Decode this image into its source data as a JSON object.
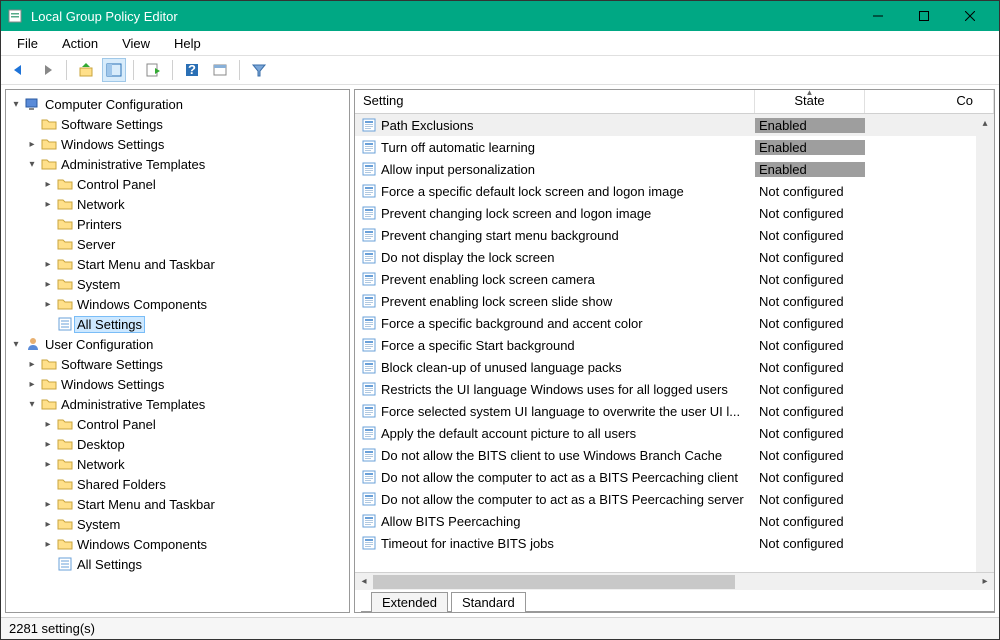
{
  "titlebar": {
    "title": "Local Group Policy Editor"
  },
  "menu": {
    "file": "File",
    "action": "Action",
    "view": "View",
    "help": "Help"
  },
  "tree": {
    "computer": "Computer Configuration",
    "user": "User Configuration",
    "software": "Software Settings",
    "windows": "Windows Settings",
    "admin": "Administrative Templates",
    "cp": "Control Panel",
    "network": "Network",
    "printers": "Printers",
    "server": "Server",
    "startmenu": "Start Menu and Taskbar",
    "system": "System",
    "wincomp": "Windows Components",
    "allsettings": "All Settings",
    "desktop": "Desktop",
    "shared": "Shared Folders"
  },
  "columns": {
    "setting": "Setting",
    "state": "State",
    "comment": "Co"
  },
  "rows": [
    {
      "name": "Path Exclusions",
      "state": "Enabled",
      "enabled": true,
      "sel": true
    },
    {
      "name": "Turn off automatic learning",
      "state": "Enabled",
      "enabled": true
    },
    {
      "name": "Allow input personalization",
      "state": "Enabled",
      "enabled": true
    },
    {
      "name": "Force a specific default lock screen and logon image",
      "state": "Not configured"
    },
    {
      "name": "Prevent changing lock screen and logon image",
      "state": "Not configured"
    },
    {
      "name": "Prevent changing start menu background",
      "state": "Not configured"
    },
    {
      "name": "Do not display the lock screen",
      "state": "Not configured"
    },
    {
      "name": "Prevent enabling lock screen camera",
      "state": "Not configured"
    },
    {
      "name": "Prevent enabling lock screen slide show",
      "state": "Not configured"
    },
    {
      "name": "Force a specific background and accent color",
      "state": "Not configured"
    },
    {
      "name": "Force a specific Start background",
      "state": "Not configured"
    },
    {
      "name": "Block clean-up of unused language packs",
      "state": "Not configured"
    },
    {
      "name": "Restricts the UI language Windows uses for all logged users",
      "state": "Not configured"
    },
    {
      "name": "Force selected system UI language to overwrite the user UI l...",
      "state": "Not configured"
    },
    {
      "name": "Apply the default account picture to all users",
      "state": "Not configured"
    },
    {
      "name": "Do not allow the BITS client to use Windows Branch Cache",
      "state": "Not configured"
    },
    {
      "name": "Do not allow the computer to act as a BITS Peercaching client",
      "state": "Not configured"
    },
    {
      "name": "Do not allow the computer to act as a BITS Peercaching server",
      "state": "Not configured"
    },
    {
      "name": "Allow BITS Peercaching",
      "state": "Not configured"
    },
    {
      "name": "Timeout for inactive BITS jobs",
      "state": "Not configured"
    }
  ],
  "tabs": {
    "extended": "Extended",
    "standard": "Standard"
  },
  "status": {
    "text": "2281 setting(s)"
  }
}
